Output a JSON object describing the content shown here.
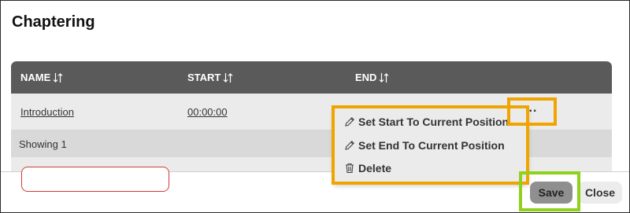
{
  "dialog": {
    "title": "Chaptering"
  },
  "table": {
    "columns": [
      {
        "label": "NAME",
        "sort_icon": "sort-arrows-icon"
      },
      {
        "label": "START",
        "sort_icon": "sort-arrows-icon"
      },
      {
        "label": "END",
        "sort_icon": "sort-arrows-icon"
      }
    ],
    "rows": [
      {
        "name": "Introduction",
        "start": "00:00:00",
        "end": "",
        "actions_label": "..."
      }
    ],
    "showing": "Showing 1"
  },
  "context_menu": {
    "items": [
      {
        "label": "Set Start To Current Position",
        "icon": "pencil-icon"
      },
      {
        "label": "Set End To Current Position",
        "icon": "pencil-icon"
      },
      {
        "label": "Delete",
        "icon": "trash-icon"
      }
    ]
  },
  "footer": {
    "save_label": "Save",
    "close_label": "Close"
  },
  "colors": {
    "header_bg": "#5a5a5a",
    "row_bg": "#ebebeb",
    "highlight_orange": "#f0a400",
    "highlight_green": "#8fd11b",
    "save_bg": "#8f8f8f"
  }
}
